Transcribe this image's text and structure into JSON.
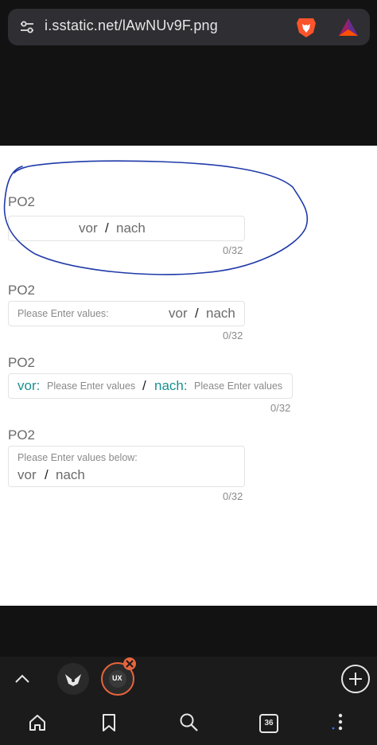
{
  "browser": {
    "url": "i.sstatic.net/lAwNUv9F.png",
    "tab_count": "36"
  },
  "icons": {
    "url_options": "tune-icon",
    "brave": "brave-lion-icon",
    "rewards": "bat-triangle-icon",
    "collapse": "chevron-up-icon",
    "tab1": "owl-icon",
    "tab2": "ux-icon",
    "close_tab": "close-icon",
    "new_tab": "plus-icon",
    "home": "home-icon",
    "bookmarks": "bookmark-icon",
    "search": "search-icon",
    "menu": "more-vertical-icon"
  },
  "colors": {
    "teal_accent": "#1a8f8f",
    "annotation": "#1f3aa8",
    "active_tab_ring": "#e8643c"
  },
  "fields": [
    {
      "label": "PO2",
      "vor": "vor",
      "slash": "/",
      "nach": "nach",
      "counter": "0/32"
    },
    {
      "label": "PO2",
      "prompt": "Please Enter values:",
      "vor": "vor",
      "slash": "/",
      "nach": "nach",
      "counter": "0/32"
    },
    {
      "label": "PO2",
      "vor": "vor:",
      "vor_placeholder": "Please Enter values",
      "slash": "/",
      "nach": "nach:",
      "nach_placeholder": "Please Enter values",
      "counter": "0/32"
    },
    {
      "label": "PO2",
      "prompt": "Please Enter values below:",
      "vor": "vor",
      "slash": "/",
      "nach": "nach",
      "counter": "0/32"
    }
  ]
}
